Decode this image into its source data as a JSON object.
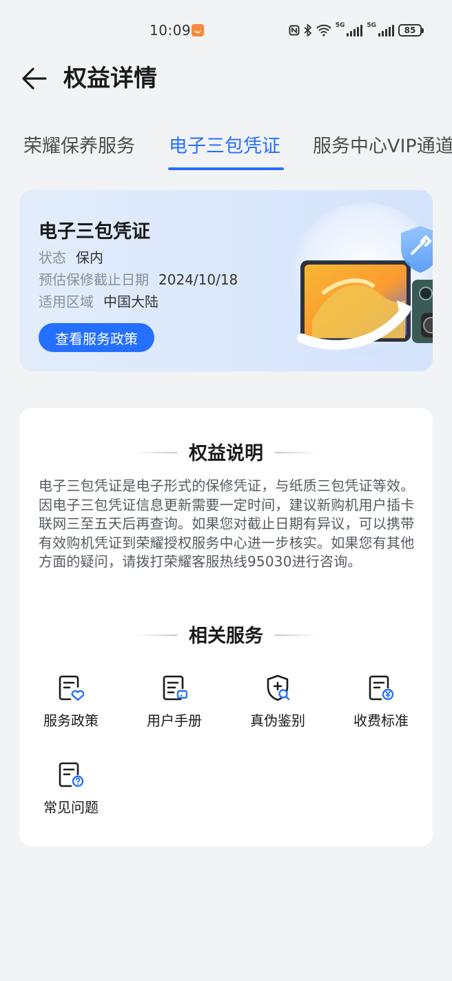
{
  "status_bar": {
    "time": "10:09",
    "battery": "85",
    "net1": "5G",
    "net2": "5G"
  },
  "header": {
    "title": "权益详情"
  },
  "tabs": [
    {
      "label": "荣耀保养服务",
      "active": false
    },
    {
      "label": "电子三包凭证",
      "active": true
    },
    {
      "label": "服务中心VIP通道",
      "active": false
    }
  ],
  "warranty": {
    "title": "电子三包凭证",
    "status_label": "状态",
    "status_value": "保内",
    "deadline_label": "预估保修截止日期",
    "deadline_value": "2024/10/18",
    "region_label": "适用区域",
    "region_value": "中国大陆",
    "button": "查看服务政策"
  },
  "rights": {
    "heading": "权益说明",
    "description": "电子三包凭证是电子形式的保修凭证，与纸质三包凭证等效。因电子三包凭证信息更新需要一定时间，建议新购机用户插卡联网三至五天后再查询。如果您对截止日期有异议，可以携带有效购机凭证到荣耀授权服务中心进一步核实。如果您有其他方面的疑问，请拨打荣耀客服热线95030进行咨询。"
  },
  "related": {
    "heading": "相关服务",
    "items": [
      {
        "label": "服务政策",
        "icon": "document-heart-icon"
      },
      {
        "label": "用户手册",
        "icon": "manual-icon"
      },
      {
        "label": "真伪鉴别",
        "icon": "shield-search-icon"
      },
      {
        "label": "收费标准",
        "icon": "document-yen-icon"
      },
      {
        "label": "常见问题",
        "icon": "document-question-icon"
      }
    ]
  },
  "colors": {
    "accent": "#256fff",
    "background": "#f1f3f5",
    "card_blue": "#dbe8fc"
  }
}
